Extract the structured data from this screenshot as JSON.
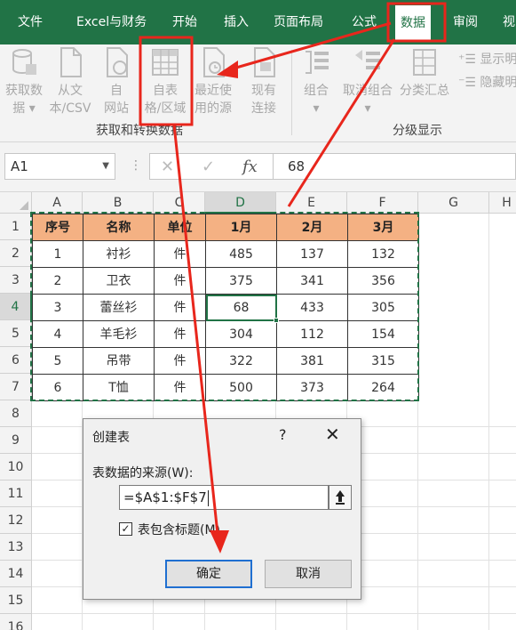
{
  "menu": {
    "items": [
      {
        "key": "file",
        "label": "文件"
      },
      {
        "key": "excel-finance",
        "label": "Excel与财务"
      },
      {
        "key": "home",
        "label": "开始"
      },
      {
        "key": "insert",
        "label": "插入"
      },
      {
        "key": "page-layout",
        "label": "页面布局"
      },
      {
        "key": "formulas",
        "label": "公式"
      },
      {
        "key": "data",
        "label": "数据"
      },
      {
        "key": "review",
        "label": "审阅"
      },
      {
        "key": "view",
        "label": "视"
      }
    ]
  },
  "ribbon": {
    "get_external_data": "获取数\n据 ▾",
    "from_text_csv": "从文\n本/CSV",
    "from_web": "自\n网站",
    "from_table": "自表\n格/区域",
    "recent_sources": "最近使\n用的源",
    "existing_connections": "现有\n连接",
    "group_get_transform": "获取和转换数据",
    "group": "组合\n▾",
    "ungroup": "取消组合\n▾",
    "subtotal": "分类汇总",
    "show_detail": "显示明",
    "hide_detail": "隐藏明",
    "group_outline": "分级显示"
  },
  "formula_bar": {
    "name_box": "A1",
    "fx": "fx",
    "value": "68"
  },
  "sheet": {
    "columns": [
      "A",
      "B",
      "C",
      "D",
      "E",
      "F",
      "G",
      "H"
    ],
    "rows": [
      "1",
      "2",
      "3",
      "4",
      "5",
      "6",
      "7",
      "8",
      "9",
      "10",
      "11",
      "12",
      "13",
      "14",
      "15",
      "16"
    ],
    "headers": [
      "序号",
      "名称",
      "单位",
      "1月",
      "2月",
      "3月"
    ],
    "data": [
      [
        "1",
        "衬衫",
        "件",
        "485",
        "137",
        "132"
      ],
      [
        "2",
        "卫衣",
        "件",
        "375",
        "341",
        "356"
      ],
      [
        "3",
        "蕾丝衫",
        "件",
        "68",
        "433",
        "305"
      ],
      [
        "4",
        "羊毛衫",
        "件",
        "304",
        "112",
        "154"
      ],
      [
        "5",
        "吊带",
        "件",
        "322",
        "381",
        "315"
      ],
      [
        "6",
        "T恤",
        "件",
        "500",
        "373",
        "264"
      ]
    ]
  },
  "dialog": {
    "title": "创建表",
    "help": "?",
    "close": "✕",
    "source_label": "表数据的来源(W):",
    "source_value": "=$A$1:$F$7",
    "collapse_icon": "⭱",
    "has_headers_label": "表包含标题(M)",
    "has_headers_checked": "✓",
    "ok": "确定",
    "cancel": "取消"
  },
  "colors": {
    "excel_green": "#217346",
    "header_fill": "#f4b183",
    "annotation_red": "#e8261c"
  }
}
